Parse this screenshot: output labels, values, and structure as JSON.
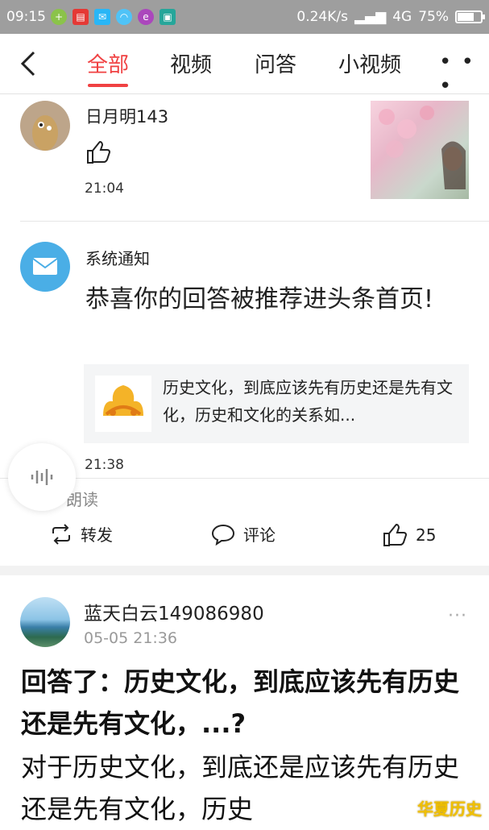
{
  "status_bar": {
    "time": "09:15",
    "network_speed": "0.24K/s",
    "network_type": "4G",
    "battery": "75%",
    "battery_level": 0.75
  },
  "nav": {
    "tabs": [
      {
        "label": "全部",
        "active": true
      },
      {
        "label": "视频",
        "active": false
      },
      {
        "label": "问答",
        "active": false
      },
      {
        "label": "小视频",
        "active": false
      }
    ],
    "more": "• • •",
    "accent_color": "#f04142"
  },
  "notif1": {
    "username": "日月明143",
    "time": "21:04"
  },
  "notif2": {
    "username": "系统通知",
    "message": "恭喜你的回答被推荐进头条首页!",
    "quote_text": "历史文化，到底应该先有历史还是先有文化，历史和文化的关系如...",
    "time": "21:38"
  },
  "floating": {
    "label": "朗读"
  },
  "actions": {
    "repost": "转发",
    "comment": "评论",
    "likes": "25"
  },
  "post": {
    "username": "蓝天白云149086980",
    "date": "05-05 21:36",
    "more": "···",
    "title": "回答了：历史文化，到底应该先有历史还是先有文化，...?",
    "body": "对于历史文化，到底还是应该先有历史还是先有文化，历史"
  },
  "watermark": "华夏历史"
}
